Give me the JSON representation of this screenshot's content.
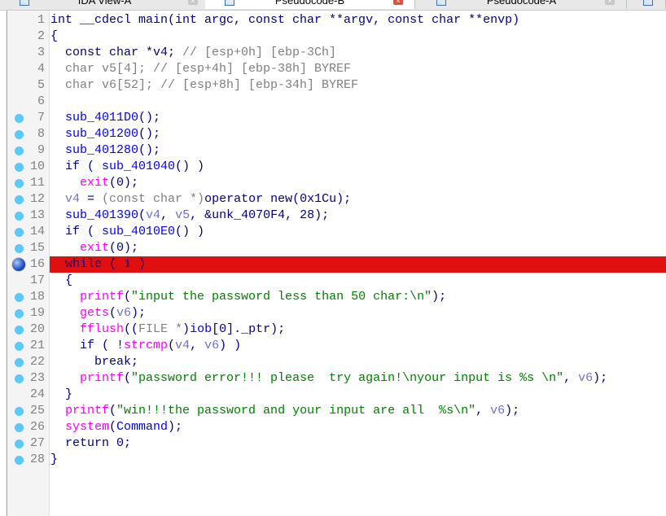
{
  "tabs": [
    {
      "label": "IDA View-A",
      "active": false
    },
    {
      "label": "Pseudocode-B",
      "active": true
    },
    {
      "label": "Pseudocode-A",
      "active": false
    }
  ],
  "colors": {
    "highlight": "#e01010",
    "breakpoint_dot": "#5bc8f5",
    "keyword": "#000080",
    "function": "#0000ff",
    "local": "#7070c8",
    "library": "#ff00ff",
    "string": "#008000",
    "comment": "#808080"
  },
  "lines": [
    {
      "n": "1",
      "dot": "",
      "tokens": [
        {
          "t": "int __cdecl main(int argc, const char **argv, const char **envp)",
          "c": "k"
        }
      ]
    },
    {
      "n": "2",
      "dot": "",
      "tokens": [
        {
          "t": "{",
          "c": "k"
        }
      ]
    },
    {
      "n": "3",
      "dot": "",
      "tokens": [
        {
          "t": "  const char *v4; ",
          "c": "k"
        },
        {
          "t": "// [esp+0h] [ebp-3Ch]",
          "c": "c"
        }
      ]
    },
    {
      "n": "4",
      "dot": "",
      "tokens": [
        {
          "t": "  char v5[4]; // [esp+4h] [ebp-38h] BYREF",
          "c": "c"
        }
      ]
    },
    {
      "n": "5",
      "dot": "",
      "tokens": [
        {
          "t": "  char v6[52]; // [esp+8h] [ebp-34h] BYREF",
          "c": "c"
        }
      ]
    },
    {
      "n": "6",
      "dot": "",
      "tokens": [
        {
          "t": "",
          "c": "k"
        }
      ]
    },
    {
      "n": "7",
      "dot": "small",
      "tokens": [
        {
          "t": "  sub_4011D0",
          "c": "f"
        },
        {
          "t": "();",
          "c": "k"
        }
      ]
    },
    {
      "n": "8",
      "dot": "small",
      "tokens": [
        {
          "t": "  sub_401200",
          "c": "f"
        },
        {
          "t": "();",
          "c": "k"
        }
      ]
    },
    {
      "n": "9",
      "dot": "small",
      "tokens": [
        {
          "t": "  sub_401280",
          "c": "f"
        },
        {
          "t": "();",
          "c": "k"
        }
      ]
    },
    {
      "n": "10",
      "dot": "small",
      "tokens": [
        {
          "t": "  if ( ",
          "c": "k"
        },
        {
          "t": "sub_401040",
          "c": "f"
        },
        {
          "t": "() )",
          "c": "k"
        }
      ]
    },
    {
      "n": "11",
      "dot": "small",
      "tokens": [
        {
          "t": "    exit",
          "c": "l"
        },
        {
          "t": "(0);",
          "c": "k"
        }
      ]
    },
    {
      "n": "12",
      "dot": "small",
      "tokens": [
        {
          "t": "  v4",
          "c": "v"
        },
        {
          "t": " = ",
          "c": "k"
        },
        {
          "t": "(const char *)",
          "c": "c"
        },
        {
          "t": "operator new(0x1Cu);",
          "c": "k"
        }
      ]
    },
    {
      "n": "13",
      "dot": "small",
      "tokens": [
        {
          "t": "  sub_401390",
          "c": "f"
        },
        {
          "t": "(",
          "c": "k"
        },
        {
          "t": "v4",
          "c": "v"
        },
        {
          "t": ", ",
          "c": "k"
        },
        {
          "t": "v5",
          "c": "v"
        },
        {
          "t": ", &unk_4070F4, 28);",
          "c": "k"
        }
      ]
    },
    {
      "n": "14",
      "dot": "small",
      "tokens": [
        {
          "t": "  if ( ",
          "c": "k"
        },
        {
          "t": "sub_4010E0",
          "c": "f"
        },
        {
          "t": "() )",
          "c": "k"
        }
      ]
    },
    {
      "n": "15",
      "dot": "small",
      "tokens": [
        {
          "t": "    exit",
          "c": "l"
        },
        {
          "t": "(0);",
          "c": "k"
        }
      ]
    },
    {
      "n": "16",
      "dot": "big",
      "hl": true,
      "tokens": [
        {
          "t": "  while ( 1 )",
          "c": "k"
        }
      ]
    },
    {
      "n": "17",
      "dot": "",
      "tokens": [
        {
          "t": "  {",
          "c": "k"
        }
      ]
    },
    {
      "n": "18",
      "dot": "small",
      "tokens": [
        {
          "t": "    printf",
          "c": "l"
        },
        {
          "t": "(",
          "c": "k"
        },
        {
          "t": "\"input the password less than 50 char:\\n\"",
          "c": "s"
        },
        {
          "t": ");",
          "c": "k"
        }
      ]
    },
    {
      "n": "19",
      "dot": "small",
      "tokens": [
        {
          "t": "    gets",
          "c": "l"
        },
        {
          "t": "(",
          "c": "k"
        },
        {
          "t": "v6",
          "c": "v"
        },
        {
          "t": ");",
          "c": "k"
        }
      ]
    },
    {
      "n": "20",
      "dot": "small",
      "tokens": [
        {
          "t": "    fflush",
          "c": "l"
        },
        {
          "t": "((",
          "c": "k"
        },
        {
          "t": "FILE *",
          "c": "c"
        },
        {
          "t": ")",
          "c": "k"
        },
        {
          "t": "iob",
          "c": "f"
        },
        {
          "t": "[0]._ptr);",
          "c": "k"
        }
      ]
    },
    {
      "n": "21",
      "dot": "small",
      "tokens": [
        {
          "t": "    if ( !",
          "c": "k"
        },
        {
          "t": "strcmp",
          "c": "l"
        },
        {
          "t": "(",
          "c": "k"
        },
        {
          "t": "v4",
          "c": "v"
        },
        {
          "t": ", ",
          "c": "k"
        },
        {
          "t": "v6",
          "c": "v"
        },
        {
          "t": ") )",
          "c": "k"
        }
      ]
    },
    {
      "n": "22",
      "dot": "small",
      "tokens": [
        {
          "t": "      break;",
          "c": "k"
        }
      ]
    },
    {
      "n": "23",
      "dot": "small",
      "tokens": [
        {
          "t": "    printf",
          "c": "l"
        },
        {
          "t": "(",
          "c": "k"
        },
        {
          "t": "\"password error!!! please  try again!\\nyour input is %s \\n\"",
          "c": "s"
        },
        {
          "t": ", ",
          "c": "k"
        },
        {
          "t": "v6",
          "c": "v"
        },
        {
          "t": ");",
          "c": "k"
        }
      ]
    },
    {
      "n": "24",
      "dot": "",
      "tokens": [
        {
          "t": "  }",
          "c": "k"
        }
      ]
    },
    {
      "n": "25",
      "dot": "small",
      "tokens": [
        {
          "t": "  printf",
          "c": "l"
        },
        {
          "t": "(",
          "c": "k"
        },
        {
          "t": "\"win!!!the password and your input are all  %s\\n\"",
          "c": "s"
        },
        {
          "t": ", ",
          "c": "k"
        },
        {
          "t": "v6",
          "c": "v"
        },
        {
          "t": ");",
          "c": "k"
        }
      ]
    },
    {
      "n": "26",
      "dot": "small",
      "tokens": [
        {
          "t": "  system",
          "c": "l"
        },
        {
          "t": "(",
          "c": "k"
        },
        {
          "t": "Command",
          "c": "f"
        },
        {
          "t": ");",
          "c": "k"
        }
      ]
    },
    {
      "n": "27",
      "dot": "small",
      "tokens": [
        {
          "t": "  return 0;",
          "c": "k"
        }
      ]
    },
    {
      "n": "28",
      "dot": "small",
      "tokens": [
        {
          "t": "}",
          "c": "k"
        }
      ]
    }
  ]
}
